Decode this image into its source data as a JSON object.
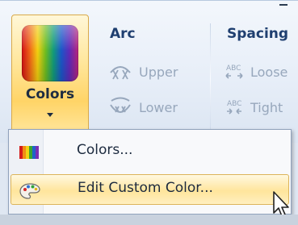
{
  "ribbon": {
    "colors_button": {
      "label": "Colors",
      "icon": "color-palette-icon"
    },
    "arc_group": {
      "title": "Arc",
      "items": [
        {
          "label": "Upper",
          "icon": "arc-upper-icon"
        },
        {
          "label": "Lower",
          "icon": "arc-lower-icon"
        }
      ]
    },
    "spacing_group": {
      "title": "Spacing",
      "items": [
        {
          "label": "Loose",
          "icon": "spacing-loose-icon"
        },
        {
          "label": "Tight",
          "icon": "spacing-tight-icon"
        }
      ]
    }
  },
  "menu": {
    "items": [
      {
        "label": "Colors...",
        "icon": "color-bars-icon",
        "highlighted": false
      },
      {
        "label": "Edit Custom Color...",
        "icon": "palette-icon",
        "highlighted": true
      }
    ]
  },
  "colors": {
    "hover_fill": "#ffe59c",
    "hover_border": "#dcb45a",
    "disabled_text": "#97a7bc",
    "group_title": "#1f3f70"
  }
}
